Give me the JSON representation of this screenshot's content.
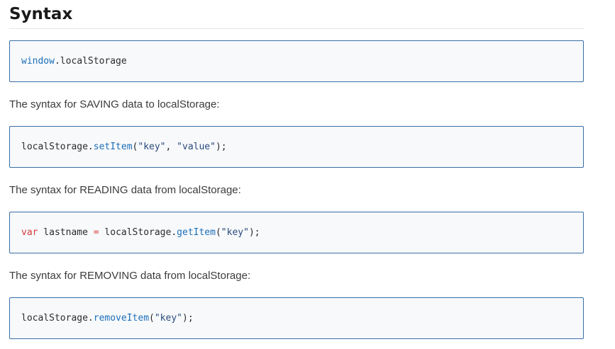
{
  "heading": "Syntax",
  "code1": {
    "obj": "window",
    "rest": ".localStorage"
  },
  "desc_saving": "The syntax for SAVING data to localStorage:",
  "code2": {
    "obj": "localStorage.",
    "fn": "setItem",
    "open": "(",
    "arg1": "\"key\"",
    "sep": ", ",
    "arg2": "\"value\"",
    "close": ");"
  },
  "desc_reading": "The syntax for READING data from localStorage:",
  "code3": {
    "kw": "var",
    "ident": " lastname ",
    "op": "=",
    "obj": " localStorage.",
    "fn": "getItem",
    "open": "(",
    "arg1": "\"key\"",
    "close": ");"
  },
  "desc_removing": "The syntax for REMOVING data from localStorage:",
  "code4": {
    "obj": "localStorage.",
    "fn": "removeItem",
    "open": "(",
    "arg1": "\"key\"",
    "close": ");"
  },
  "colors": {
    "code_border": "#3a6ea5",
    "code_background": "#f7f9fb",
    "keyword": "#d63b3b",
    "function": "#1d6fb8"
  }
}
